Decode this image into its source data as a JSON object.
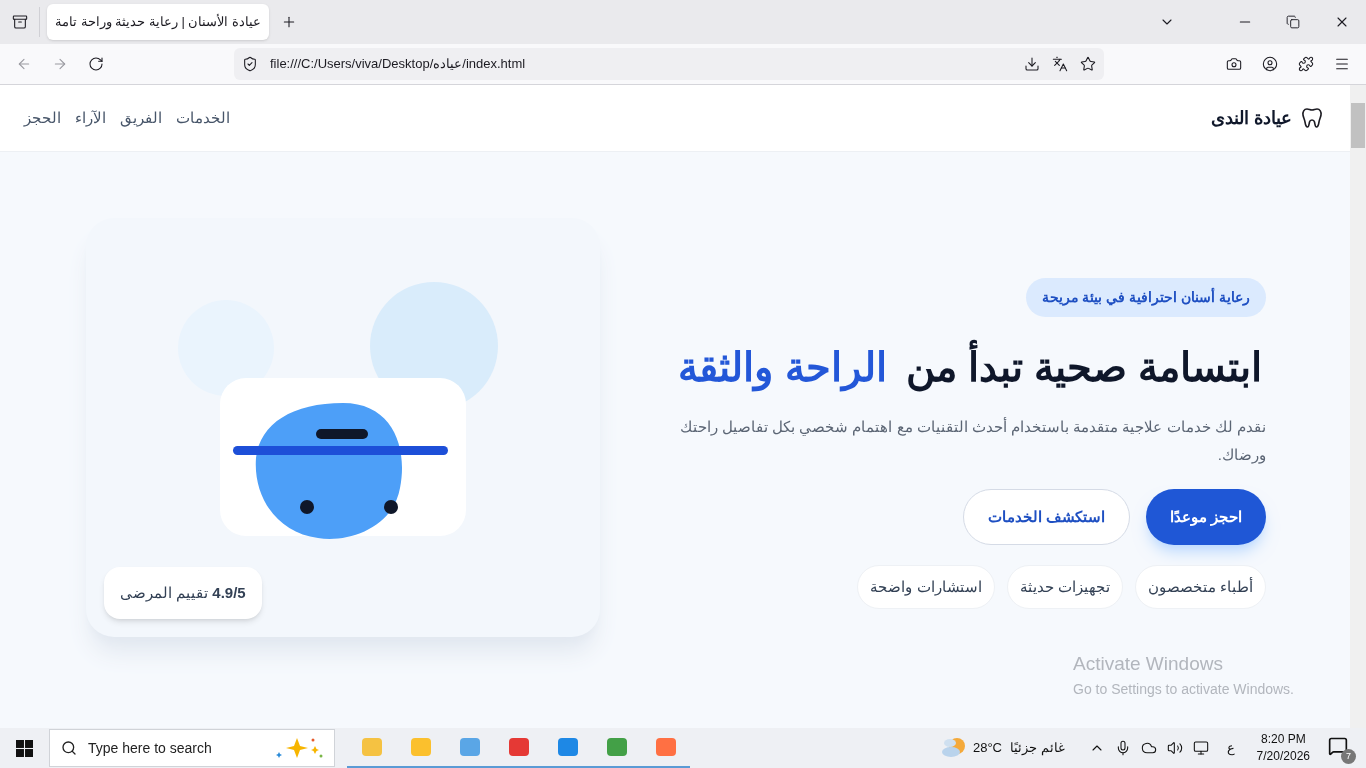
{
  "browser": {
    "tab_title": "عيادة الأسنان | رعاية حديثة وراحة تامة",
    "tab_selected": true,
    "url": "file:///C:/Users/viva/Desktop/عياده/index.html"
  },
  "site": {
    "logo": "عيادة الندى",
    "nav": [
      "الخدمات",
      "الفريق",
      "الآراء",
      "الحجز"
    ]
  },
  "hero": {
    "badge": "رعاية أسنان احترافية في بيئة مريحة",
    "headline": "ابتسامة صحية تبدأ من",
    "headline_highlight": "الراحة والثقة",
    "description": "نقدم لك خدمات علاجية متقدمة باستخدام أحدث التقنيات مع اهتمام شخصي بكل تفاصيل راحتك ورضاك.",
    "buttons": [
      {
        "label": "احجز موعدًا",
        "kind": "primary"
      },
      {
        "label": "استكشف الخدمات",
        "kind": "secondary"
      }
    ],
    "features": [
      "أطباء متخصصون",
      "تجهيزات حديثة",
      "استشارات واضحة"
    ],
    "rating": "**4.9/5** تقييم المرضى"
  },
  "activation": {
    "title": "Activate Windows",
    "subtitle": "Go to Settings to activate Windows."
  },
  "taskbar": {
    "search_placeholder": "Type here to search",
    "weather_temp": "28°C",
    "weather_text": "غائم جزئيًا",
    "language": "ع",
    "time": "8:20 PM",
    "date": "7/20/2026",
    "notifications": "7"
  }
}
